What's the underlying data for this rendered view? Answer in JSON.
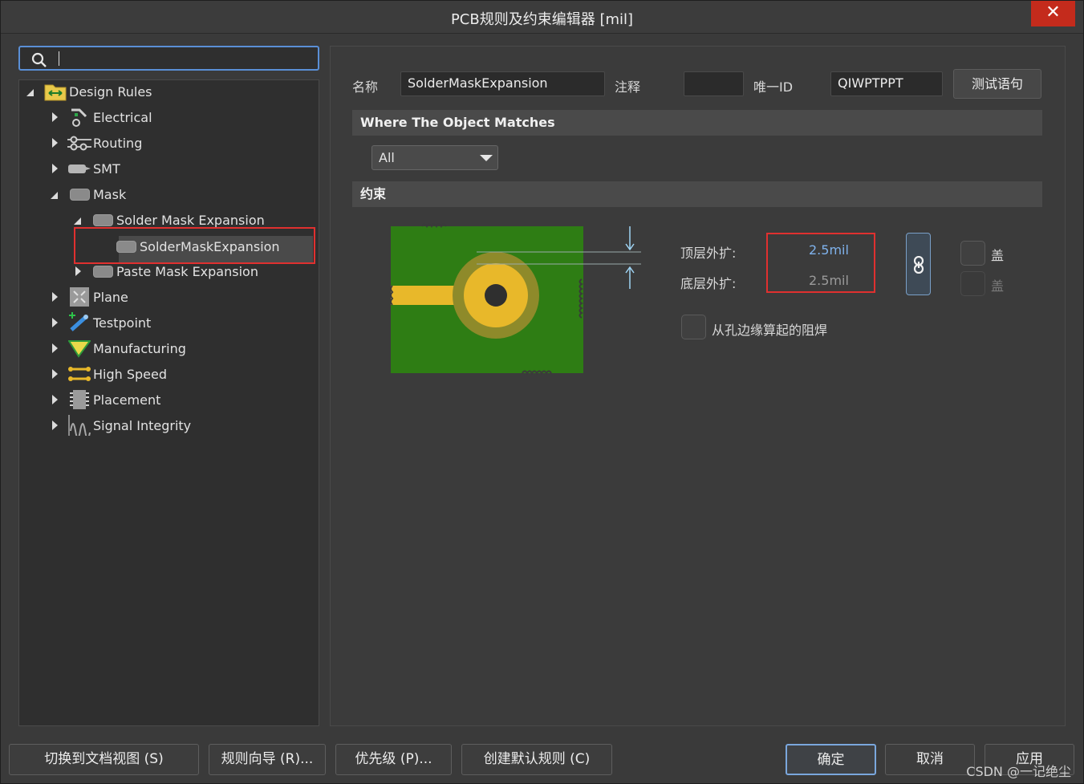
{
  "window": {
    "title": "PCB规则及约束编辑器 [mil]",
    "close_glyph": "✕"
  },
  "search": {
    "value": ""
  },
  "tree": {
    "root": "Design Rules",
    "items": {
      "electrical": "Electrical",
      "routing": "Routing",
      "smt": "SMT",
      "mask": "Mask",
      "solder_mask_expansion": "Solder Mask Expansion",
      "solder_mask_rule": "SolderMaskExpansion",
      "paste_mask_expansion": "Paste Mask Expansion",
      "plane": "Plane",
      "testpoint": "Testpoint",
      "manufacturing": "Manufacturing",
      "high_speed": "High Speed",
      "placement": "Placement",
      "signal_integrity": "Signal Integrity"
    }
  },
  "rule": {
    "name_label": "名称",
    "name_value": "SolderMaskExpansion",
    "comment_label": "注释",
    "comment_value": "",
    "uid_label": "唯一ID",
    "uid_value": "QIWPTPPT",
    "test_button": "测试语句"
  },
  "match": {
    "section_title": "Where The Object Matches",
    "selected": "All"
  },
  "constraints": {
    "section_title": "约束",
    "top_label": "顶层外扩:",
    "top_value": "2.5mil",
    "bottom_label": "底层外扩:",
    "bottom_value": "2.5mil",
    "tent_top": "盖",
    "tent_bottom": "盖",
    "from_hole_edge": "从孔边缘算起的阻焊"
  },
  "colors": {
    "board_green": "#2e7d14",
    "pad_yellow": "#e8b82a",
    "accent_blue": "#7aa7dd",
    "highlight_red": "#e0302f"
  },
  "buttons": {
    "switch_doc": "切换到文档视图 (S)",
    "wizard": "规则向导 (R)...",
    "priority": "优先级 (P)...",
    "create_default": "创建默认规则 (C)",
    "ok": "确定",
    "cancel": "取消",
    "apply": "应用"
  },
  "watermark": "CSDN @一记绝尘"
}
